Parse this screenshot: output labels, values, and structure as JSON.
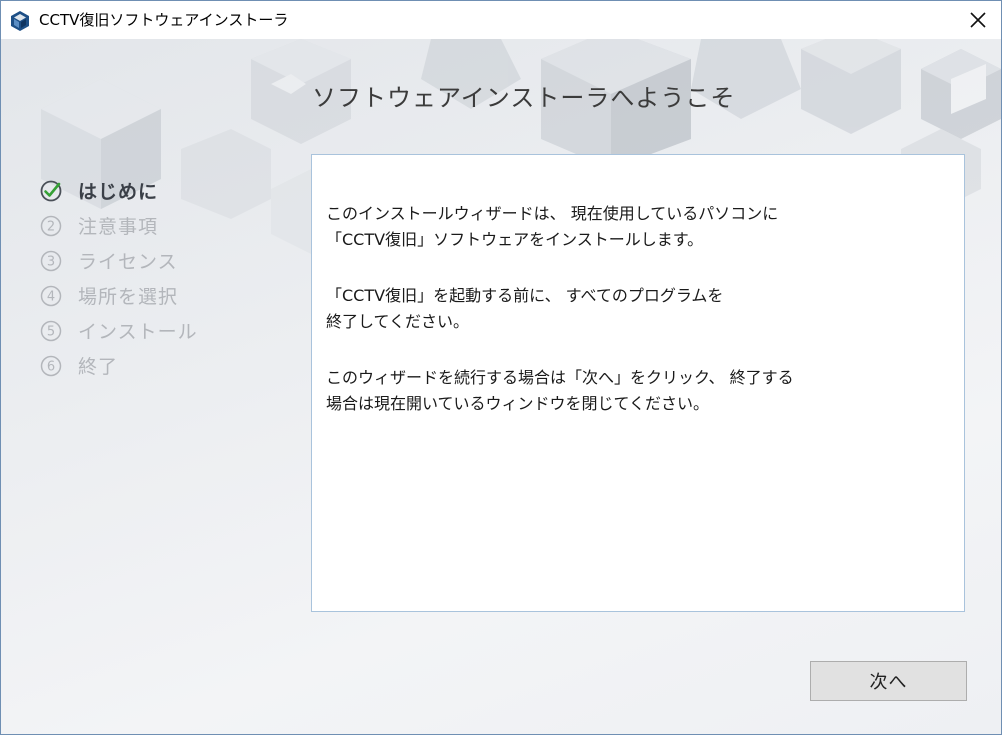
{
  "window": {
    "title": "CCTV復旧ソフトウェアインストーラ"
  },
  "heading": "ソフトウェアインストーラへようこそ",
  "steps": [
    {
      "label": "はじめに",
      "state": "completed",
      "icon": "check-circle-icon"
    },
    {
      "label": "注意事項",
      "state": "pending",
      "icon": "number-2-circle-icon"
    },
    {
      "label": "ライセンス",
      "state": "pending",
      "icon": "number-3-circle-icon"
    },
    {
      "label": "場所を選択",
      "state": "pending",
      "icon": "number-4-circle-icon"
    },
    {
      "label": "インストール",
      "state": "pending",
      "icon": "number-5-circle-icon"
    },
    {
      "label": "終了",
      "state": "pending",
      "icon": "number-6-circle-icon"
    }
  ],
  "body": {
    "p1": [
      "このインストールウィザードは、 現在使用しているパソコンに",
      "「CCTV復旧」ソフトウェアをインストールします。"
    ],
    "p2": [
      "「CCTV復旧」を起動する前に、 すべてのプログラムを",
      "終了してください。"
    ],
    "p3": [
      "このウィザードを続行する場合は「次へ」をクリック、 終了する",
      "場合は現在開いているウィンドウを閉じてください。"
    ]
  },
  "buttons": {
    "next_label": "次へ"
  },
  "colors": {
    "check": "#35a035",
    "step_active": "#3a3f47",
    "step_inactive": "#b3b6bb",
    "panel_border": "#a9c3dc"
  }
}
